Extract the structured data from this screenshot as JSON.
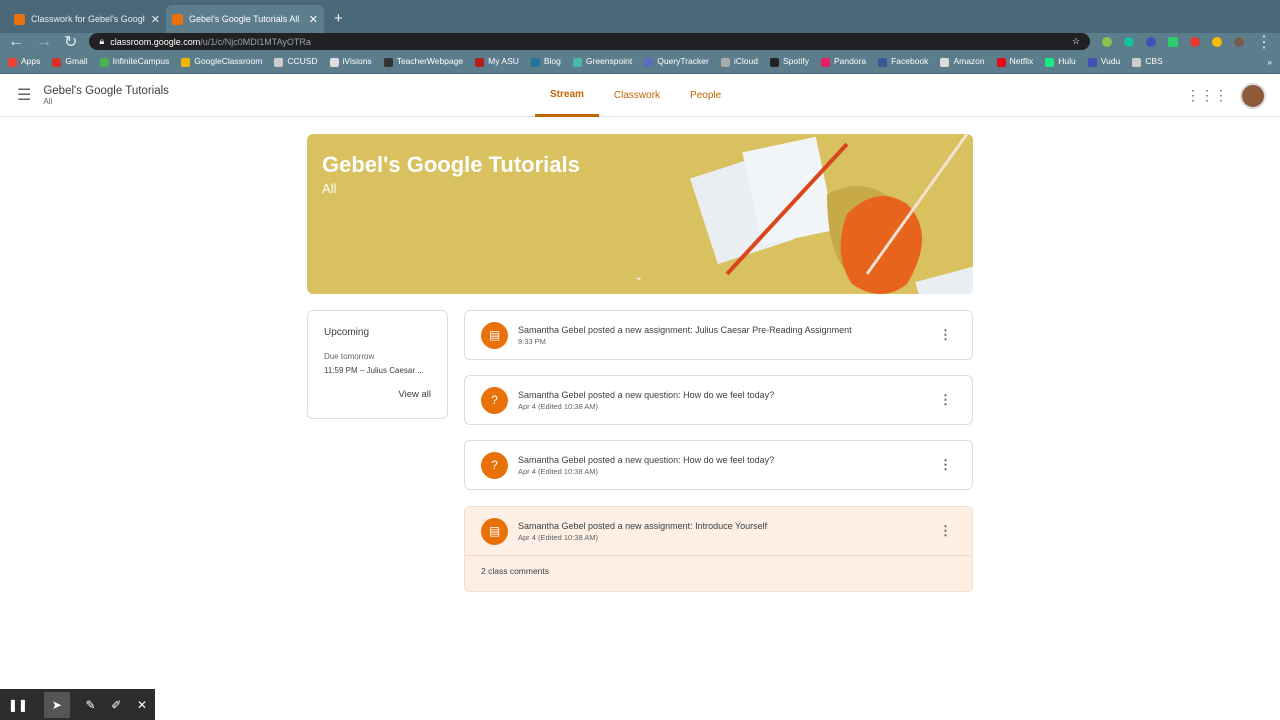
{
  "browser": {
    "tabs": [
      {
        "title": "Classwork for Gebel's Google T",
        "active": false
      },
      {
        "title": "Gebel's Google Tutorials All",
        "active": true
      }
    ],
    "url_host": "classroom.google.com",
    "url_path": "/u/1/c/Njc0MDI1MTAyOTRa",
    "bookmarks": [
      "Apps",
      "Gmail",
      "InfiniteCampus",
      "GoogleClassroom",
      "CCUSD",
      "iVisions",
      "TeacherWebpage",
      "My ASU",
      "Blog",
      "Greenspoint",
      "QueryTracker",
      "iCloud",
      "Spotify",
      "Pandora",
      "Facebook",
      "Amazon",
      "Netflix",
      "Hulu",
      "Vudu",
      "CBS"
    ]
  },
  "header": {
    "class_name": "Gebel's Google Tutorials",
    "section": "All",
    "tabs": [
      "Stream",
      "Classwork",
      "People"
    ],
    "active_tab": "Stream"
  },
  "banner": {
    "title": "Gebel's Google Tutorials",
    "section": "All",
    "color": "#d9c160"
  },
  "upcoming": {
    "title": "Upcoming",
    "due": "Due tomorrow",
    "item": "11:59 PM – Julius Caesar ...",
    "view_all": "View all"
  },
  "posts": [
    {
      "icon": "assignment-icon",
      "text": "Samantha Gebel posted a new assignment: Julius Caesar Pre-Reading Assignment",
      "meta": "9:33 PM"
    },
    {
      "icon": "question-icon",
      "text": "Samantha Gebel posted a new question: How do we feel today?",
      "meta": "Apr 4 (Edited 10:38 AM)"
    },
    {
      "icon": "question-icon",
      "text": "Samantha Gebel posted a new question: How do we feel today?",
      "meta": "Apr 4 (Edited 10:38 AM)"
    },
    {
      "icon": "assignment-icon",
      "text": "Samantha Gebel posted a new assignment: Introduce Yourself",
      "meta": "Apr 4 (Edited 10:38 AM)",
      "comments": "2 class comments"
    }
  ],
  "accent": "#e8710a"
}
